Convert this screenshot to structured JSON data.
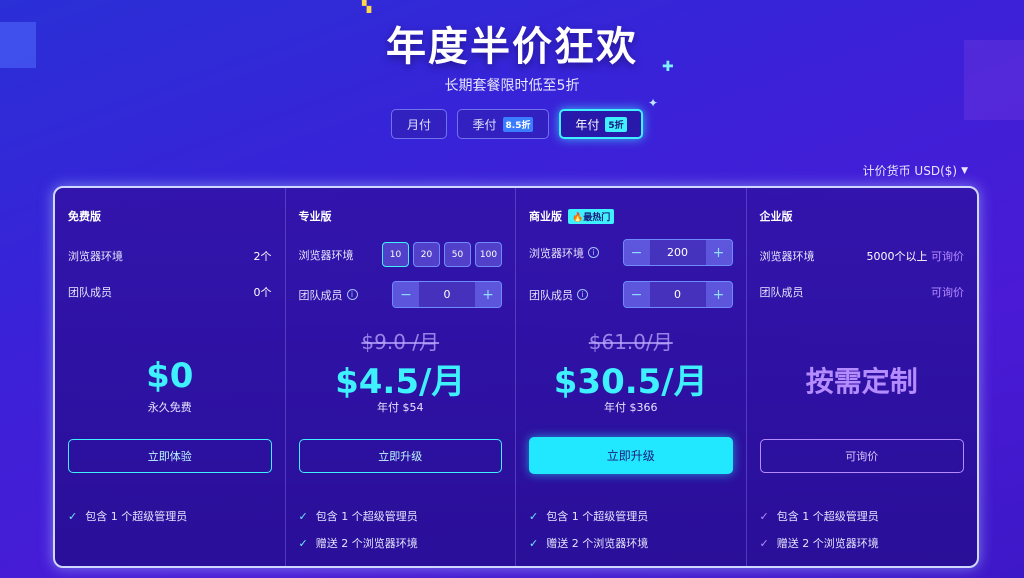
{
  "header": {
    "title": "年度半价狂欢",
    "subtitle": "长期套餐限时低至5折"
  },
  "billing_tabs": [
    {
      "label": "月付",
      "badge": ""
    },
    {
      "label": "季付",
      "badge": "8.5折"
    },
    {
      "label": "年付",
      "badge": "5折",
      "active": true
    }
  ],
  "currency": {
    "label": "计价货币 USD($)"
  },
  "plans": {
    "free": {
      "name": "免费版",
      "env_label": "浏览器环境",
      "env_value": "2个",
      "members_label": "团队成员",
      "members_value": "0个",
      "price": "$0",
      "price_note": "永久免费",
      "cta": "立即体验",
      "features": [
        "包含 1 个超级管理员"
      ]
    },
    "pro": {
      "name": "专业版",
      "env_label": "浏览器环境",
      "env_options": [
        "10",
        "20",
        "50",
        "100"
      ],
      "members_label": "团队成员",
      "members_value": "0",
      "old_price": "$9.0 /月",
      "price": "$4.5/月",
      "price_note": "年付 $54",
      "cta": "立即升级",
      "features": [
        "包含 1 个超级管理员",
        "赠送 2 个浏览器环境"
      ]
    },
    "business": {
      "name": "商业版",
      "badge": "🔥最热门",
      "env_label": "浏览器环境",
      "env_value": "200",
      "members_label": "团队成员",
      "members_value": "0",
      "old_price": "$61.0/月",
      "price": "$30.5/月",
      "price_note": "年付 $366",
      "cta": "立即升级",
      "features": [
        "包含 1 个超级管理员",
        "赠送 2 个浏览器环境"
      ]
    },
    "enterprise": {
      "name": "企业版",
      "env_label": "浏览器环境",
      "env_value": "5000个以上",
      "env_link": "可询价",
      "members_label": "团队成员",
      "members_link": "可询价",
      "price": "按需定制",
      "cta": "可询价",
      "features": [
        "包含 1 个超级管理员",
        "赠送 2 个浏览器环境"
      ]
    }
  },
  "colors": {
    "accent": "#3ff0ff",
    "purple_accent": "#b58cff",
    "background": "#3a22d8"
  }
}
